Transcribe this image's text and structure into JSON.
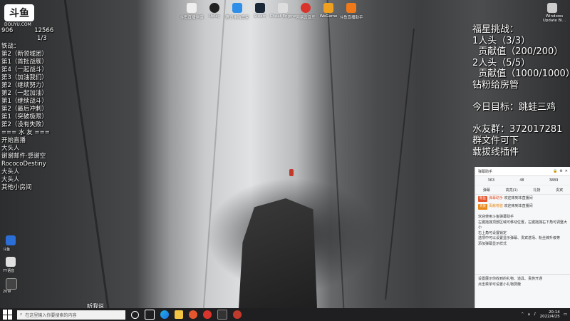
{
  "overlay": {
    "logo_main": "斗鱼",
    "logo_sub": "DOUYU.COM",
    "room_id": "12566",
    "room_number": "906",
    "ratio": "1/3",
    "left_lines": [
      "铁战：",
      "第2（新领域团）",
      "第1（首批战舰）",
      "第4（一起战斗）",
      "第3（加油我们）",
      "第2（继续努力）",
      "第2（一起加油）",
      "第1（继续战斗）",
      "第2（最后冲刺）",
      "第1（突破极限）"
    ],
    "left_lines_2": [
      "第2（没有失败）",
      "=== 水 友 ===",
      "开始直播",
      "大头人",
      "谢谢邮件·感谢空",
      "RococoDestiny",
      "大头人",
      "大头人",
      "其他小房间"
    ],
    "right_lines": [
      "福星挑战：",
      "1人头（3/3）",
      "  贡献值（200/200）",
      "2人头（5/5）",
      "  贡献值（1000/1000）",
      "钻粉给房管",
      "",
      "今日目标：跳蛙三鸡",
      "",
      "水友群：372017281",
      "群文件可下",
      "载拔线插件"
    ],
    "streamer_label": "听我说"
  },
  "desktop": {
    "top_icons": [
      "斗鱼直播伴侣",
      "Uplay",
      "腾讯电脑管家",
      "Steam",
      "Cheat Engine",
      "网易云音乐",
      "WeGame",
      "斗鱼直播助手"
    ],
    "right_icon": "Windows Update Bl...",
    "left_small_icons": [
      "斗鱼",
      "YY语音",
      "20W"
    ]
  },
  "chat_panel": {
    "title": "弹幕助手",
    "stats": [
      "363",
      "48",
      "3889"
    ],
    "tabs": [
      "弹幕",
      "高亮(1)",
      "礼物",
      "贵宾"
    ],
    "messages": [
      {
        "badge": "粉丝",
        "badge_color": "#e4572e",
        "name": "弹幕助手",
        "text": "欢迎来到本直播间"
      },
      {
        "badge": "贵族",
        "badge_color": "#e88a1a",
        "name": "贡献榜首",
        "text": "欢迎来到本直播间"
      }
    ],
    "notice": [
      "欢迎使用斗鱼弹幕助手",
      "左键拖拽顶部区域可移动位置，左键拖拽右下角可调整大小",
      "右上角可设置锁定",
      "选项中可以设置显示弹幕、贵宾进场、粉丝牌升级等",
      "添加弹幕显示样式"
    ],
    "footer": [
      "设置展示你收到的礼物、道具、贵族开通",
      "点击菜单可设置小礼物屏蔽"
    ]
  },
  "taskbar": {
    "search_placeholder": "在这里输入你要搜索的内容",
    "time": "20:14",
    "date": "2022/4/25"
  },
  "colors": {
    "taskbar": "#1f1f22",
    "chat_bg": "#f6f7f8",
    "overlay_text": "#ffffff"
  }
}
